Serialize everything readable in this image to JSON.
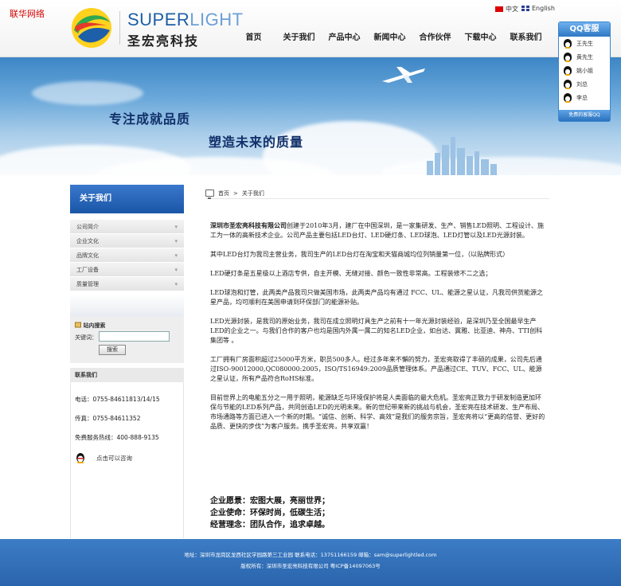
{
  "site": {
    "tag": "联华网络",
    "logo_en_a": "SUPER",
    "logo_en_b": "LIGHT",
    "logo_cn": "圣宏亮科技",
    "lang_cn": "中文",
    "lang_en": "English"
  },
  "nav": [
    "首页",
    "关于我们",
    "产品中心",
    "新闻中心",
    "合作伙伴",
    "下载中心",
    "联系我们"
  ],
  "banner": {
    "slogan1": "专注成就品质",
    "slogan2": "塑造未来的质量"
  },
  "qq": {
    "title": "QQ客服",
    "contacts": [
      "王先生",
      "黄先生",
      "姚小姐",
      "刘总",
      "李总"
    ],
    "footer": "免费的客服QQ"
  },
  "sidebar": {
    "title": "关于我们",
    "menu": [
      "公司简介",
      "企业文化",
      "品牌文化",
      "工厂设备",
      "质量管理"
    ],
    "search_title": "站内搜索",
    "search_label": "关键词：",
    "search_button": "搜索",
    "contact_title": "联系我们",
    "phone": "电话：0755-84611813/14/15",
    "fax": "传真：0755-84611352",
    "hotline": "免费服务热线：400-888-9135",
    "chat": "点击可以咨询"
  },
  "breadcrumb": {
    "home": "首页",
    "sep": ">",
    "current": "关于我们"
  },
  "content": {
    "company_name": "深圳市圣宏亮科技有限公司",
    "p1": "创建于2010年3月，建厂在中国深圳，是一家集研发、生产、销售LED照明、工程设计、施工为一体的高新技术企业。公司产品主要包括LED台灯、LED硬灯条、LED球泡、LED灯管以及LED光源封装。",
    "p2": "其中LED台灯为我司主营业务，我司生产的LED台灯在淘宝和天猫商城均位列销量第一位，（以贴牌形式）",
    "p3": "LED硬灯条是五星级以上酒店专供，自主开模、无缝对接、颜色一致性非常高。工程装修不二之选；",
    "p4": "LED球泡和灯管，此两类产品我司只做美国市场，此两类产品均有通过 FCC、UL、能源之星认证，凡我司供货能源之星产品，均可顺利在美国申请到环保部门的能源补贴。",
    "p5": "LED光源封装，是我司的原始业务，我司在成立照明灯具生产之前有十一年光源封装经验，是深圳乃至全国最早生产LED的企业之一。与我们合作的客户也均是国内外属一属二的知名LED企业，如台达、冀雅、比亚迪、神舟、TTI创科集团等 。",
    "p6": "工厂拥有厂房面积超过25000平方米，职员500多人。经过多年来不懈的努力，圣宏亮取得了丰硕的成果，公司先后通过ISO-90012000,QC080000:2005，ISO/TS16949:2009品质管理体系。产品通过CE、TUV、FCC、UL、能源之星认证，所有产品符合RoHS标准。",
    "p7": "目前世界上的电能五分之一用于照明，能源缺乏与环境保护将是人类面临的最大危机。圣宏亮正致力于研发制造更加环保与节能的LED系列产品，共同创造LED的光明未来。新的世纪带来新的挑战与机会，圣宏亮在技术研发、生产布局、市场通路等方面已进入一个新的时期。“诚信、创新、科学、高效”是我们的服务宗旨，圣宏亮将以“更高的信誉、更好的品质、更快的步伐”为客户服务。携手圣宏亮，共享双赢！",
    "motto1": "企业愿景：宏图大展，亮丽世界；",
    "motto2": "企业使命：环保时尚，低碳生活；",
    "motto3": "经营理念：团队合作，追求卓越。"
  },
  "footer": {
    "line1": "地址：深圳市龙岗区龙西社区学园路第三工业园  联系电话：13751166159 邮箱：sam@superlightled.com",
    "line2": "版权所有：深圳市圣宏亮科技有限公司      粤ICP备14097063号"
  },
  "colors": {
    "brand_blue": "#1d5fa8",
    "footer_blue": "#2f6cb5",
    "tag_red": "#d40000"
  }
}
